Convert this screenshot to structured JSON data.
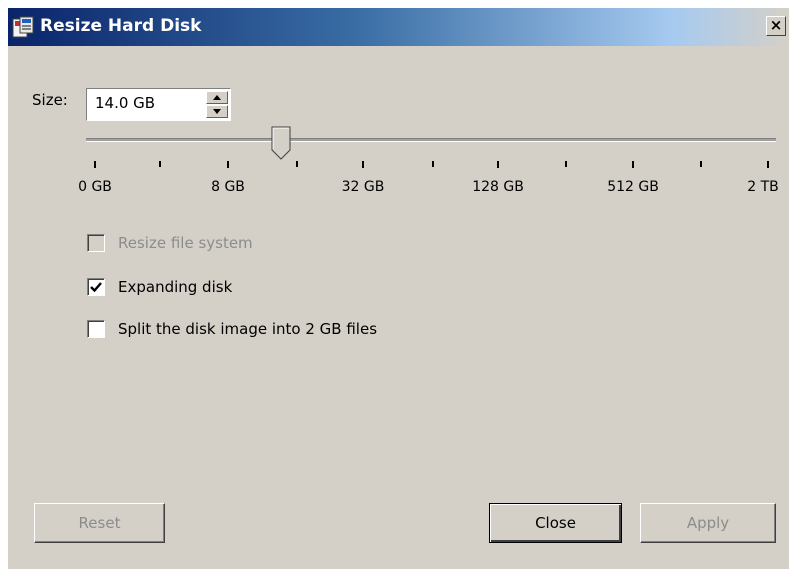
{
  "window": {
    "title": "Resize Hard Disk",
    "close_glyph": "×"
  },
  "size": {
    "label": "Size:",
    "value": "14.0 GB"
  },
  "slider": {
    "ticks": [
      "0 GB",
      "8 GB",
      "32 GB",
      "128 GB",
      "512 GB",
      "2 TB"
    ]
  },
  "options": {
    "resize_fs": {
      "label": "Resize file system",
      "checked": false,
      "enabled": false
    },
    "expanding": {
      "label": "Expanding disk",
      "checked": true,
      "enabled": true
    },
    "split": {
      "label": "Split the disk image into 2 GB files",
      "checked": false,
      "enabled": true
    }
  },
  "buttons": {
    "reset": "Reset",
    "close": "Close",
    "apply": "Apply"
  },
  "icons": {
    "app": "disk-app-icon",
    "close": "close-icon",
    "spin_up": "arrow-up-icon",
    "spin_down": "arrow-down-icon",
    "check": "checkmark-icon"
  }
}
